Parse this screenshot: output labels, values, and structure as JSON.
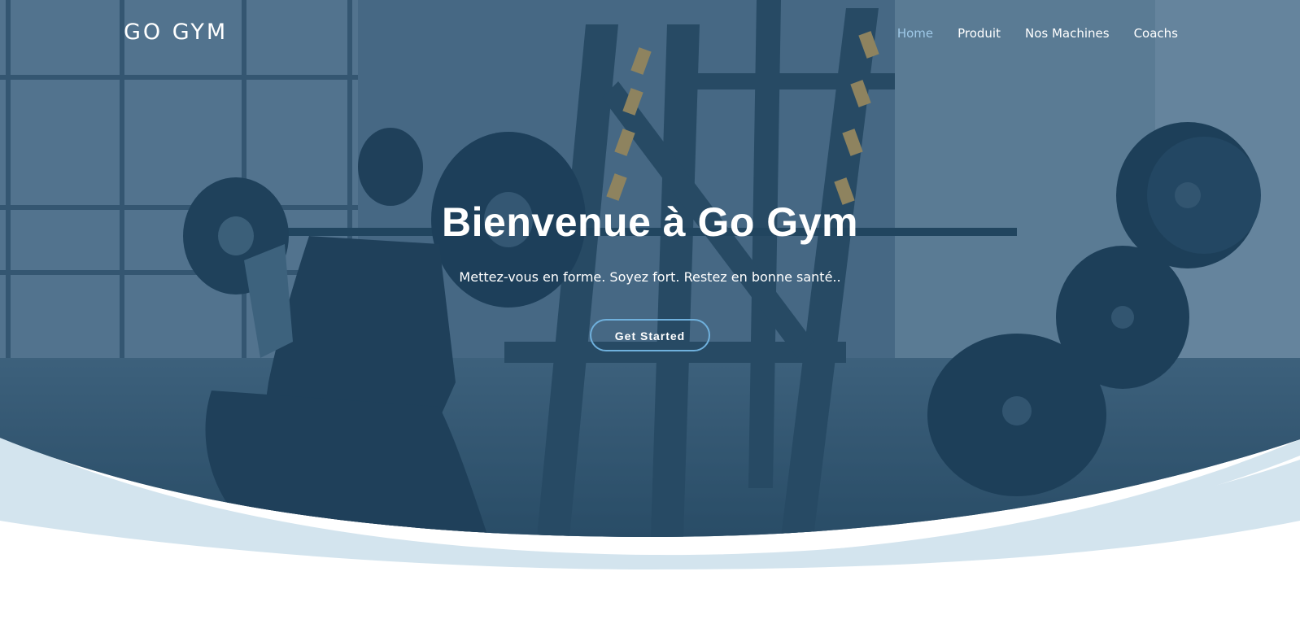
{
  "brand": {
    "logo_text": "GO GYM"
  },
  "nav": {
    "items": [
      {
        "label": "Home",
        "active": true
      },
      {
        "label": "Produit",
        "active": false
      },
      {
        "label": "Nos Machines",
        "active": false
      },
      {
        "label": "Coachs",
        "active": false
      }
    ]
  },
  "hero": {
    "title": "Bienvenue à Go Gym",
    "subtitle": "Mettez-vous en forme. Soyez fort. Restez en bonne santé..",
    "cta_label": "Get Started",
    "background_image": "gym-barbell-squat-photo"
  },
  "colors": {
    "overlay": "#2a4f6b",
    "wave_light": "#d3e4ee",
    "active_nav": "#9fc9e8",
    "button_border": "#6fb0dc"
  }
}
